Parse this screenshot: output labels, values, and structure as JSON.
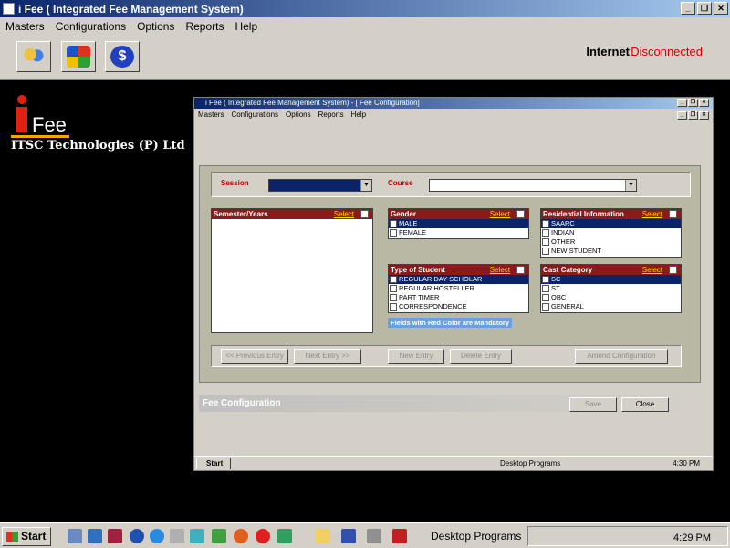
{
  "window": {
    "title": "i Fee ( Integrated Fee Management System)"
  },
  "menu": [
    "Masters",
    "Configurations",
    "Options",
    "Reports",
    "Help"
  ],
  "status": {
    "internet_label": "Internet",
    "connection": "Disconnected"
  },
  "logo": {
    "text": "Fee",
    "company": "ITSC Technologies (P) Ltd"
  },
  "dialog": {
    "title": "i Fee ( Integrated Fee Management System) - [ Fee Configuration]",
    "menu": [
      "Masters",
      "Configurations",
      "Options",
      "Reports",
      "Help"
    ],
    "session_label": "Session",
    "course_label": "Course",
    "semester": {
      "header": "Semester/Years",
      "select_all": "Select"
    },
    "gender": {
      "header": "Gender",
      "select_all": "Select",
      "items": [
        "MALE",
        "FEMALE"
      ]
    },
    "residential": {
      "header": "Residential Information",
      "select_all": "Select",
      "items": [
        "SAARC",
        "INDIAN",
        "OTHER",
        "NEW STUDENT"
      ]
    },
    "student_type": {
      "header": "Type of Student",
      "select_all": "Select",
      "items": [
        "REGULAR DAY SCHOLAR",
        "REGULAR HOSTELLER",
        "PART TIMER",
        "CORRESPONDENCE"
      ]
    },
    "cast": {
      "header": "Cast Category",
      "select_all": "Select",
      "items": [
        "SC",
        "ST",
        "OBC",
        "GENERAL"
      ]
    },
    "mandatory_note": "Fields with Red Color are Mandatory",
    "buttons": {
      "prev": "<< Previous Entry",
      "next": "Next Entry >>",
      "new": "New Entry",
      "delete": "Delete Entry",
      "amend": "Amend Configuration",
      "save": "Save",
      "close": "Close"
    },
    "status_title": "Fee Configuration",
    "taskbar": {
      "start": "Start",
      "programs": "Desktop Programs",
      "clock": "4:30 PM"
    }
  },
  "taskbar": {
    "start": "Start",
    "programs": "Desktop Programs",
    "clock": "4:29 PM"
  },
  "colors": {
    "accent": "#0a246a",
    "header_red": "#8b1a1a",
    "mandatory": "#c00000"
  }
}
